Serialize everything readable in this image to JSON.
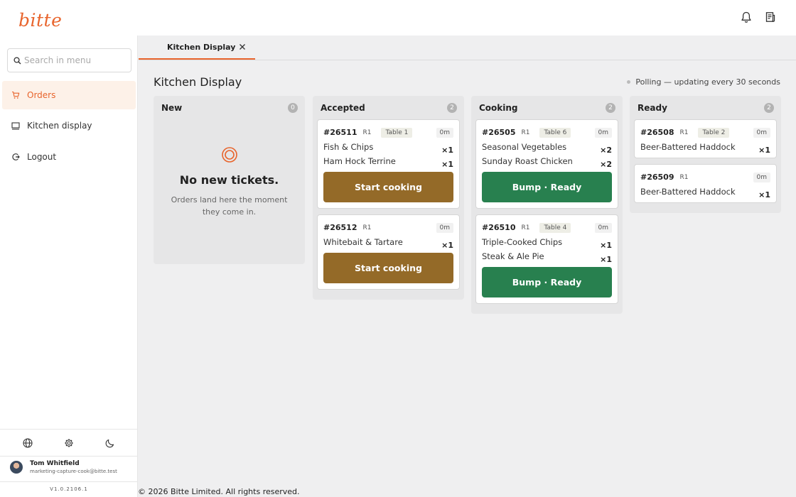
{
  "app": {
    "logo": "bitte"
  },
  "header": {
    "notifications_icon": "bell-icon",
    "receipts_icon": "receipt-icon"
  },
  "sidebar": {
    "search_placeholder": "Search in menu",
    "items": [
      {
        "label": "Orders",
        "icon": "cart-icon",
        "active": true
      },
      {
        "label": "Kitchen display",
        "icon": "monitor-icon",
        "active": false
      },
      {
        "label": "Logout",
        "icon": "logout-icon",
        "active": false
      }
    ],
    "user": {
      "name": "Tom Whitfield",
      "email": "marketing-capture-cook@bitte.test"
    },
    "version": "V1.0.2106.1"
  },
  "tab": {
    "label": "Kitchen Display"
  },
  "page": {
    "title": "Kitchen Display",
    "polling": "Polling — updating every 30 seconds"
  },
  "columns": {
    "new": {
      "title": "New",
      "count": "0",
      "empty_title": "No new tickets.",
      "empty_sub": "Orders land here the moment they come in."
    },
    "accepted": {
      "title": "Accepted",
      "count": "2",
      "tickets": [
        {
          "number": "#26511",
          "room": "R1",
          "table": "Table 1",
          "age": "0m",
          "items": [
            {
              "name": "Fish & Chips",
              "qty": "×1"
            },
            {
              "name": "Ham Hock Terrine",
              "qty": "×1"
            }
          ],
          "action": "Start cooking"
        },
        {
          "number": "#26512",
          "room": "R1",
          "table": "",
          "age": "0m",
          "items": [
            {
              "name": "Whitebait & Tartare",
              "qty": "×1"
            }
          ],
          "action": "Start cooking"
        }
      ]
    },
    "cooking": {
      "title": "Cooking",
      "count": "2",
      "tickets": [
        {
          "number": "#26505",
          "room": "R1",
          "table": "Table 6",
          "age": "0m",
          "items": [
            {
              "name": "Seasonal Vegetables",
              "qty": "×2"
            },
            {
              "name": "Sunday Roast Chicken",
              "qty": "×2"
            }
          ],
          "action": "Bump · Ready"
        },
        {
          "number": "#26510",
          "room": "R1",
          "table": "Table 4",
          "age": "0m",
          "items": [
            {
              "name": "Triple-Cooked Chips",
              "qty": "×1"
            },
            {
              "name": "Steak & Ale Pie",
              "qty": "×1"
            }
          ],
          "action": "Bump · Ready"
        }
      ]
    },
    "ready": {
      "title": "Ready",
      "count": "2",
      "tickets": [
        {
          "number": "#26508",
          "room": "R1",
          "table": "Table 2",
          "age": "0m",
          "items": [
            {
              "name": "Beer-Battered Haddock",
              "qty": "×1"
            }
          ]
        },
        {
          "number": "#26509",
          "room": "R1",
          "table": "",
          "age": "0m",
          "items": [
            {
              "name": "Beer-Battered Haddock",
              "qty": "×1"
            }
          ]
        }
      ]
    }
  },
  "footer": {
    "text": "© 2026 Bitte Limited. All rights reserved."
  },
  "colors": {
    "brand": "#e8642c",
    "start": "#946a28",
    "bump": "#28804f"
  }
}
